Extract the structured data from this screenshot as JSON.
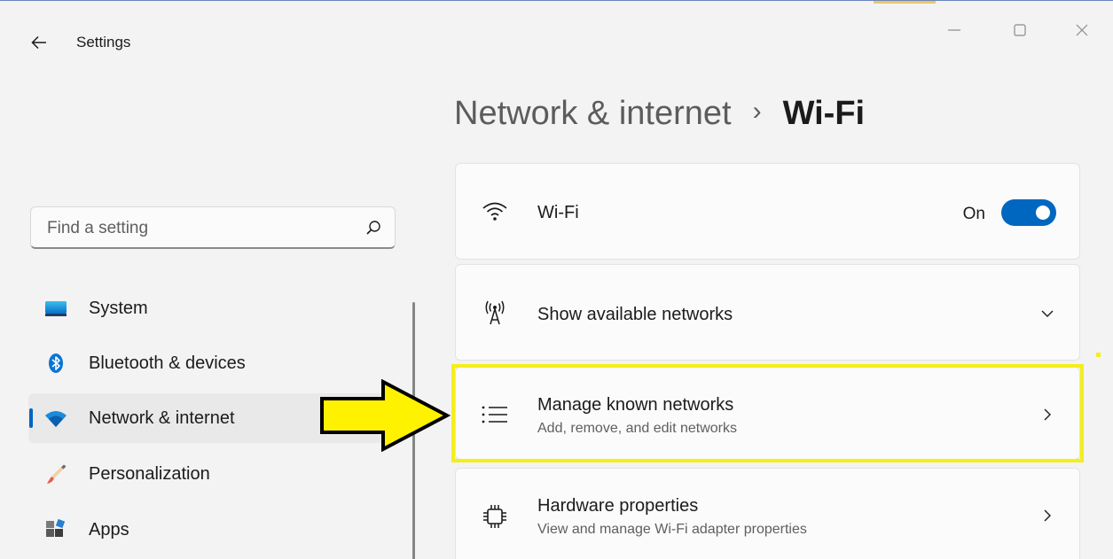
{
  "window": {
    "title": "Settings",
    "controls": [
      "minimize",
      "maximize",
      "close"
    ]
  },
  "search": {
    "placeholder": "Find a setting",
    "icon": "search-icon"
  },
  "sidebar": {
    "items": [
      {
        "label": "System",
        "icon": "system-display-icon",
        "active": false
      },
      {
        "label": "Bluetooth & devices",
        "icon": "bluetooth-icon",
        "active": false
      },
      {
        "label": "Network & internet",
        "icon": "wifi-icon",
        "active": true
      },
      {
        "label": "Personalization",
        "icon": "paintbrush-icon",
        "active": false
      },
      {
        "label": "Apps",
        "icon": "apps-icon",
        "active": false
      }
    ]
  },
  "breadcrumb": {
    "parent": "Network & internet",
    "separator": "›",
    "current": "Wi-Fi"
  },
  "cards": [
    {
      "title": "Wi-Fi",
      "icon": "wifi-signal-icon",
      "toggle_label": "On",
      "toggle_on": true
    },
    {
      "title": "Show available networks",
      "icon": "antenna-icon",
      "control": "chevron-down"
    },
    {
      "title": "Manage known networks",
      "subtitle": "Add, remove, and edit networks",
      "icon": "list-icon",
      "control": "chevron-right",
      "highlighted": true
    },
    {
      "title": "Hardware properties",
      "subtitle": "View and manage Wi-Fi adapter properties",
      "icon": "chip-icon",
      "control": "chevron-right"
    }
  ],
  "colors": {
    "accent": "#0067c0",
    "highlight": "#f4ee1b",
    "background": "#f3f3f3",
    "card": "#fbfbfb"
  }
}
